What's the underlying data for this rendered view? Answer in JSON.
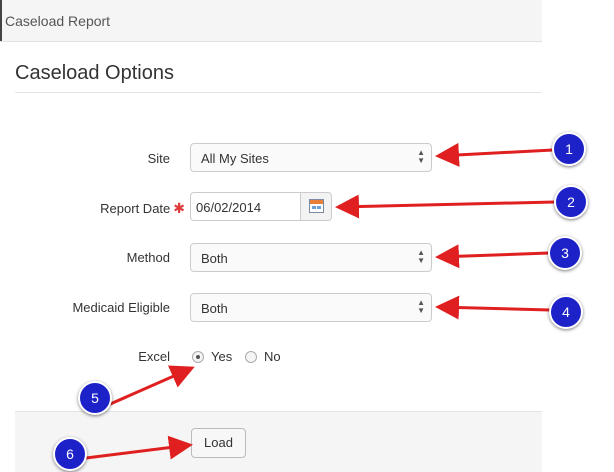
{
  "header": {
    "title": "Caseload Report"
  },
  "page": {
    "heading": "Caseload Options"
  },
  "form": {
    "site": {
      "label": "Site",
      "value": "All My Sites"
    },
    "report_date": {
      "label": "Report Date",
      "required_mark": "✱",
      "value": "06/02/2014"
    },
    "method": {
      "label": "Method",
      "value": "Both"
    },
    "medicaid": {
      "label": "Medicaid Eligible",
      "value": "Both"
    },
    "excel": {
      "label": "Excel",
      "options": [
        "Yes",
        "No"
      ],
      "selected": "Yes"
    }
  },
  "actions": {
    "load_label": "Load"
  },
  "annotations": {
    "color": "#e02020",
    "badge_color": "#1d22c8",
    "badges": [
      "1",
      "2",
      "3",
      "4",
      "5",
      "6"
    ]
  },
  "icons": {
    "select_caret": "▲▼"
  }
}
